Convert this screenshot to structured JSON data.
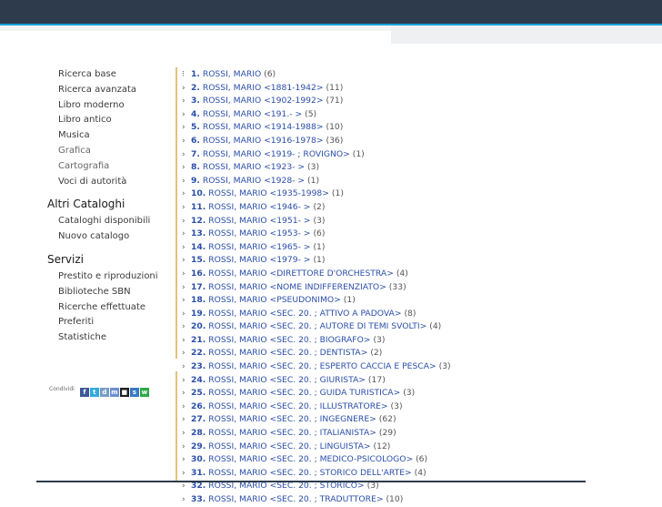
{
  "sidebar": {
    "search_items": [
      {
        "label": "Ricerca base",
        "muted": false
      },
      {
        "label": "Ricerca avanzata",
        "muted": false
      },
      {
        "label": "Libro moderno",
        "muted": false
      },
      {
        "label": "Libro antico",
        "muted": false
      },
      {
        "label": "Musica",
        "muted": false
      },
      {
        "label": "Grafica",
        "muted": true
      },
      {
        "label": "Cartografia",
        "muted": true
      },
      {
        "label": "Voci di autorità",
        "muted": false
      }
    ],
    "altri_title": "Altri Cataloghi",
    "altri_items": [
      "Cataloghi disponibili",
      "Nuovo catalogo"
    ],
    "servizi_title": "Servizi",
    "servizi_items": [
      "Prestito e riproduzioni",
      "Biblioteche SBN",
      "Ricerche effettuate",
      "Preferiti",
      "Statistiche"
    ],
    "share_label": "Condividi"
  },
  "results": [
    {
      "num": "1.",
      "name": "ROSSI, MARIO",
      "count": "(6)"
    },
    {
      "num": "2.",
      "name": "ROSSI, MARIO <1881-1942>",
      "count": "(11)"
    },
    {
      "num": "3.",
      "name": "ROSSI, MARIO <1902-1992>",
      "count": "(71)"
    },
    {
      "num": "4.",
      "name": "ROSSI, MARIO <191.- >",
      "count": "(5)"
    },
    {
      "num": "5.",
      "name": "ROSSI, MARIO <1914-1988>",
      "count": "(10)"
    },
    {
      "num": "6.",
      "name": "ROSSI, MARIO <1916-1978>",
      "count": "(36)"
    },
    {
      "num": "7.",
      "name": "ROSSI, MARIO <1919- ; ROVIGNO>",
      "count": "(1)"
    },
    {
      "num": "8.",
      "name": "ROSSI, MARIO <1923- >",
      "count": "(3)"
    },
    {
      "num": "9.",
      "name": "ROSSI, MARIO <1928- >",
      "count": "(1)"
    },
    {
      "num": "10.",
      "name": "ROSSI, MARIO <1935-1998>",
      "count": "(1)"
    },
    {
      "num": "11.",
      "name": "ROSSI, MARIO <1946- >",
      "count": "(2)"
    },
    {
      "num": "12.",
      "name": "ROSSI, MARIO <1951- >",
      "count": "(3)"
    },
    {
      "num": "13.",
      "name": "ROSSI, MARIO <1953- >",
      "count": "(6)"
    },
    {
      "num": "14.",
      "name": "ROSSI, MARIO <1965- >",
      "count": "(1)"
    },
    {
      "num": "15.",
      "name": "ROSSI, MARIO <1979- >",
      "count": "(1)"
    },
    {
      "num": "16.",
      "name": "ROSSI, MARIO <DIRETTORE D'ORCHESTRA>",
      "count": "(4)"
    },
    {
      "num": "17.",
      "name": "ROSSI, MARIO <NOME INDIFFERENZIATO>",
      "count": "(33)"
    },
    {
      "num": "18.",
      "name": "ROSSI, MARIO <PSEUDONIMO>",
      "count": "(1)"
    },
    {
      "num": "19.",
      "name": "ROSSI, MARIO <SEC. 20. ; ATTIVO A PADOVA>",
      "count": "(8)"
    },
    {
      "num": "20.",
      "name": "ROSSI, MARIO <SEC. 20. ; AUTORE DI TEMI SVOLTI>",
      "count": "(4)"
    },
    {
      "num": "21.",
      "name": "ROSSI, MARIO <SEC. 20. ; BIOGRAFO>",
      "count": "(3)"
    },
    {
      "num": "22.",
      "name": "ROSSI, MARIO <SEC. 20. ; DENTISTA>",
      "count": "(2)"
    },
    {
      "num": "23.",
      "name": "ROSSI, MARIO <SEC. 20. ; ESPERTO CACCIA E PESCA>",
      "count": "(3)"
    },
    {
      "num": "24.",
      "name": "ROSSI, MARIO <SEC. 20. ; GIURISTA>",
      "count": "(17)"
    },
    {
      "num": "25.",
      "name": "ROSSI, MARIO <SEC. 20. ; GUIDA TURISTICA>",
      "count": "(3)"
    },
    {
      "num": "26.",
      "name": "ROSSI, MARIO <SEC. 20. ; ILLUSTRATORE>",
      "count": "(3)"
    },
    {
      "num": "27.",
      "name": "ROSSI, MARIO <SEC. 20. ; INGEGNERE>",
      "count": "(62)"
    },
    {
      "num": "28.",
      "name": "ROSSI, MARIO <SEC. 20. ; ITALIANISTA>",
      "count": "(29)"
    },
    {
      "num": "29.",
      "name": "ROSSI, MARIO <SEC. 20. ; LINGUISTA>",
      "count": "(12)"
    },
    {
      "num": "30.",
      "name": "ROSSI, MARIO <SEC. 20. ; MEDICO-PSICOLOGO>",
      "count": "(6)"
    },
    {
      "num": "31.",
      "name": "ROSSI, MARIO <SEC. 20. ; STORICO DELL'ARTE>",
      "count": "(4)"
    },
    {
      "num": "32.",
      "name": "ROSSI, MARIO <SEC. 20. ; STORICO>",
      "count": "(3)"
    },
    {
      "num": "33.",
      "name": "ROSSI, MARIO <SEC. 20. ; TRADUTTORE>",
      "count": "(10)"
    }
  ],
  "share_icons": [
    {
      "name": "facebook-icon",
      "color": "#3b5998",
      "glyph": "f"
    },
    {
      "name": "twitter-icon",
      "color": "#33a9e0",
      "glyph": "t"
    },
    {
      "name": "digg-icon",
      "color": "#7a9cc6",
      "glyph": "d"
    },
    {
      "name": "myspace-icon",
      "color": "#6b8fd0",
      "glyph": "m"
    },
    {
      "name": "delicious-icon",
      "color": "#222222",
      "glyph": "■"
    },
    {
      "name": "share-icon",
      "color": "#3a79c4",
      "glyph": "s"
    },
    {
      "name": "whatsapp-icon",
      "color": "#2ea84a",
      "glyph": "w"
    }
  ]
}
